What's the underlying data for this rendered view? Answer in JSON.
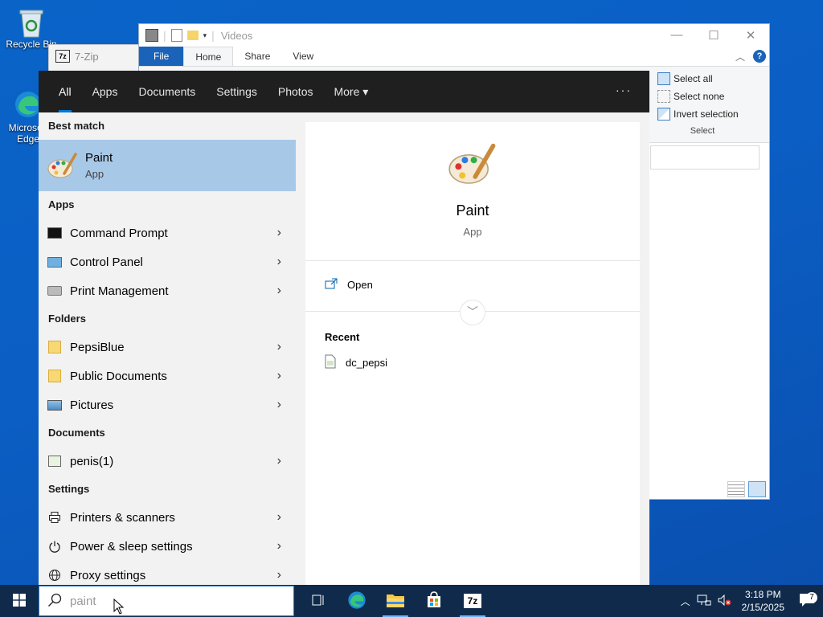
{
  "desktop": {
    "icons": [
      {
        "label": "Recycle Bin",
        "icon": "recycle-bin-icon"
      },
      {
        "label": "Microsoft Edge",
        "icon": "edge-icon"
      }
    ]
  },
  "windows": {
    "zip": {
      "title": "7-Zip"
    },
    "explorer": {
      "title": "Videos",
      "tabs": [
        "File",
        "Home",
        "Share",
        "View"
      ],
      "select_group": {
        "items": [
          "Select all",
          "Select none",
          "Invert selection"
        ],
        "label": "Select"
      }
    }
  },
  "search": {
    "tabs": [
      {
        "label": "All",
        "active": true
      },
      {
        "label": "Apps"
      },
      {
        "label": "Documents"
      },
      {
        "label": "Settings"
      },
      {
        "label": "Photos"
      },
      {
        "label": "More ▾"
      }
    ],
    "more_options": "···",
    "best_match": {
      "header": "Best match",
      "name": "Paint",
      "type": "App",
      "icon": "paint-palette-icon"
    },
    "apps": {
      "header": "Apps",
      "items": [
        {
          "label": "Command Prompt",
          "icon": "command-prompt-icon"
        },
        {
          "label": "Control Panel",
          "icon": "control-panel-icon"
        },
        {
          "label": "Print Management",
          "icon": "print-management-icon"
        }
      ]
    },
    "folders": {
      "header": "Folders",
      "items": [
        {
          "label": "PepsiBlue",
          "icon": "folder-icon"
        },
        {
          "label": "Public Documents",
          "icon": "folder-icon"
        },
        {
          "label": "Pictures",
          "icon": "pictures-folder-icon"
        }
      ]
    },
    "documents": {
      "header": "Documents",
      "items": [
        {
          "label": "penis(1)",
          "icon": "image-file-icon"
        }
      ]
    },
    "settings": {
      "header": "Settings",
      "items": [
        {
          "label": "Printers & scanners",
          "icon": "printer-icon"
        },
        {
          "label": "Power & sleep settings",
          "icon": "power-icon"
        },
        {
          "label": "Proxy settings",
          "icon": "globe-icon"
        }
      ]
    },
    "preview": {
      "name": "Paint",
      "type": "App",
      "open_label": "Open",
      "recent_header": "Recent",
      "recent_files": [
        "dc_pepsi"
      ]
    }
  },
  "taskbar": {
    "search_value": "paint",
    "apps": [
      {
        "icon": "task-view-icon",
        "running": false
      },
      {
        "icon": "edge-icon",
        "running": false
      },
      {
        "icon": "file-explorer-icon",
        "running": true
      },
      {
        "icon": "store-icon",
        "running": false
      },
      {
        "icon": "7zip-icon",
        "running": true
      }
    ],
    "time": "3:18 PM",
    "date": "2/15/2025",
    "notification_count": "7"
  }
}
